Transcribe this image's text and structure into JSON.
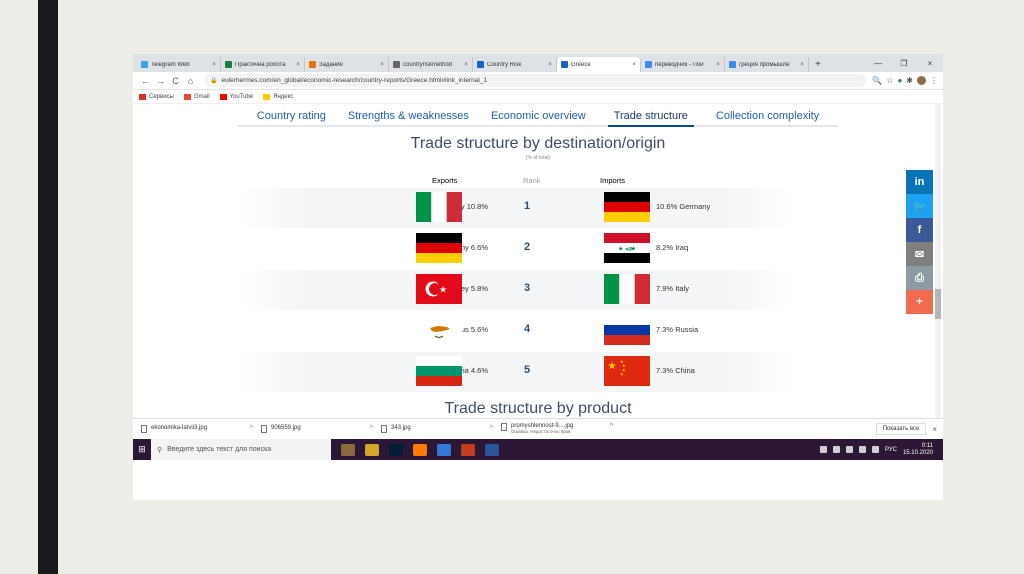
{
  "browser": {
    "tabs": [
      {
        "label": "Telegram Web",
        "color": "#3aa3e3"
      },
      {
        "label": "Практична робота",
        "color": "#188038"
      },
      {
        "label": "Задание",
        "color": "#e8710a"
      },
      {
        "label": "countryriskmethod",
        "color": "#666666"
      },
      {
        "label": "Country Risk",
        "color": "#1565c0"
      },
      {
        "label": "Greece",
        "color": "#1565c0",
        "active": true
      },
      {
        "label": "переводчик - Пои",
        "color": "#4285f4"
      },
      {
        "label": "греция промышле",
        "color": "#4285f4"
      }
    ],
    "close_glyph": "×",
    "new_tab_glyph": "+",
    "window_controls": [
      "—",
      "❐",
      "×"
    ],
    "url": "eulerhermes.com/en_global/economic-research/country-reports/Greece.html#link_internal_1",
    "nav": {
      "back": "←",
      "forward": "→",
      "reload": "C",
      "home": "⌂"
    },
    "bookmarks": [
      {
        "label": "Сервисы",
        "color": "#d93025"
      },
      {
        "label": "Gmail",
        "color": "#ea4335"
      },
      {
        "label": "YouTube",
        "color": "#ff0000"
      },
      {
        "label": "Яндекс",
        "color": "#ffcc00"
      }
    ]
  },
  "page": {
    "nav_tabs": [
      "Country rating",
      "Strengths & weaknesses",
      "Economic overview",
      "Trade structure",
      "Collection complexity"
    ],
    "active_tab": "Trade structure",
    "title": "Trade structure by destination/origin",
    "subtitle": "(% of total)",
    "headers": {
      "exports": "Exports",
      "rank": "Rank",
      "imports": "Imports"
    },
    "rows": [
      {
        "rank": "1",
        "export_country": "Italy",
        "export_pct": "10.8%",
        "export_flag": "italy",
        "import_country": "Germany",
        "import_pct": "10.6%",
        "import_flag": "germany"
      },
      {
        "rank": "2",
        "export_country": "Germany",
        "export_pct": "6.6%",
        "export_flag": "germany",
        "import_country": "Iraq",
        "import_pct": "8.2%",
        "import_flag": "iraq"
      },
      {
        "rank": "3",
        "export_country": "Turkey",
        "export_pct": "5.8%",
        "export_flag": "turkey",
        "import_country": "Italy",
        "import_pct": "7.9%",
        "import_flag": "italy"
      },
      {
        "rank": "4",
        "export_country": "Cyprus",
        "export_pct": "5.6%",
        "export_flag": "cyprus",
        "import_country": "Russia",
        "import_pct": "7.3%",
        "import_flag": "russia"
      },
      {
        "rank": "5",
        "export_country": "Bulgaria",
        "export_pct": "4.6%",
        "export_flag": "bulgaria",
        "import_country": "China",
        "import_pct": "7.3%",
        "import_flag": "china"
      }
    ],
    "next_section": "Trade structure by product",
    "social": [
      {
        "name": "linkedin-icon",
        "glyph": "in",
        "color": "#0a74b5"
      },
      {
        "name": "twitter-icon",
        "glyph": "🐦",
        "color": "#1da1f2"
      },
      {
        "name": "facebook-icon",
        "glyph": "f",
        "color": "#3b5998"
      },
      {
        "name": "email-icon",
        "glyph": "✉",
        "color": "#7f7f7f"
      },
      {
        "name": "print-icon",
        "glyph": "⎙",
        "color": "#8c9aa3"
      },
      {
        "name": "more-share-icon",
        "glyph": "+",
        "color": "#f26a4f"
      }
    ]
  },
  "downloads": [
    {
      "name": "ekonomika-latvii3.jpg",
      "sub": ""
    },
    {
      "name": "906559.jpg",
      "sub": ""
    },
    {
      "name": "343.jpg",
      "sub": ""
    },
    {
      "name": "promyshlennost-9....jpg",
      "sub": "Ошибка. Недостаточно прав"
    }
  ],
  "downloads_show_all": "Показать все",
  "taskbar": {
    "search_placeholder": "Введите здесь текст для поиска",
    "lang": "РУС",
    "time": "0:11",
    "date": "15.10.2020",
    "app_colors": [
      "#8b6b3a",
      "#d4a72c",
      "#001e36",
      "#ff7c00",
      "#2f7bd6",
      "#c43e1c",
      "#2b579a"
    ]
  }
}
